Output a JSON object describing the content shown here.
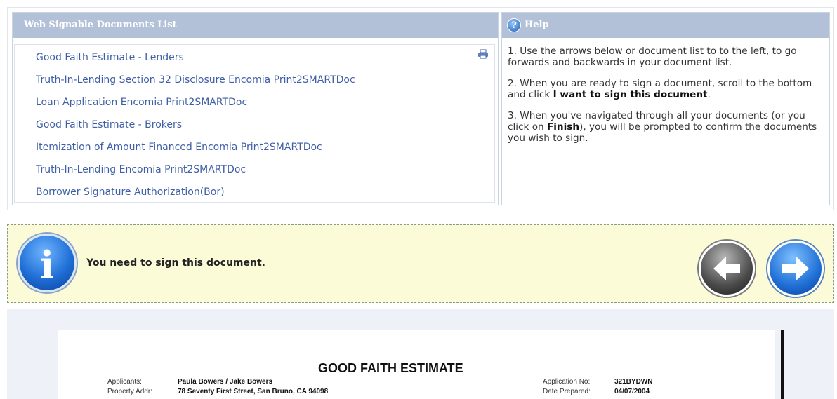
{
  "docs_panel": {
    "title": "Web Signable Documents List",
    "items": [
      "Good Faith Estimate - Lenders",
      "Truth-In-Lending Section 32 Disclosure Encomia Print2SMARTDoc",
      "Loan Application Encomia Print2SMARTDoc",
      "Good Faith Estimate - Brokers",
      "Itemization of Amount Financed Encomia Print2SMARTDoc",
      "Truth-In-Lending Encomia Print2SMARTDoc",
      "Borrower Signature Authorization(Bor)"
    ],
    "print_icon": "printer-icon"
  },
  "help": {
    "title": "Help",
    "icon": "help-icon",
    "p1": "1. Use the arrows below or document list to to the left, to go forwards and backwards in your document list.",
    "p2_pre": "2. When you are ready to sign a document, scroll to the bottom and click ",
    "p2_bold": "I want to sign this document",
    "p2_post": ".",
    "p3_pre": "3. When you've navigated through all your documents (or you click on ",
    "p3_bold": "Finish",
    "p3_post": "), you will be prompted to confirm the documents you wish to sign."
  },
  "notice": {
    "icon": "info-icon",
    "text": "You need to sign this document.",
    "prev_icon": "arrow-left-icon",
    "next_icon": "arrow-right-icon"
  },
  "document": {
    "title": "GOOD FAITH ESTIMATE",
    "applicants_label": "Applicants:",
    "applicants_value": "Paula Bowers / Jake Bowers",
    "property_label": "Property Addr:",
    "property_value": "78 Seventy First Street, San Bruno, CA 94098",
    "app_no_label": "Application No:",
    "app_no_value": "321BYDWN",
    "date_label": "Date Prepared:",
    "date_value": "04/07/2004"
  },
  "colors": {
    "header_bg": "#b3c1d8",
    "link": "#3f5fa6",
    "notice_bg": "#fbfbd8",
    "doc_area_bg": "#eef1f7"
  }
}
